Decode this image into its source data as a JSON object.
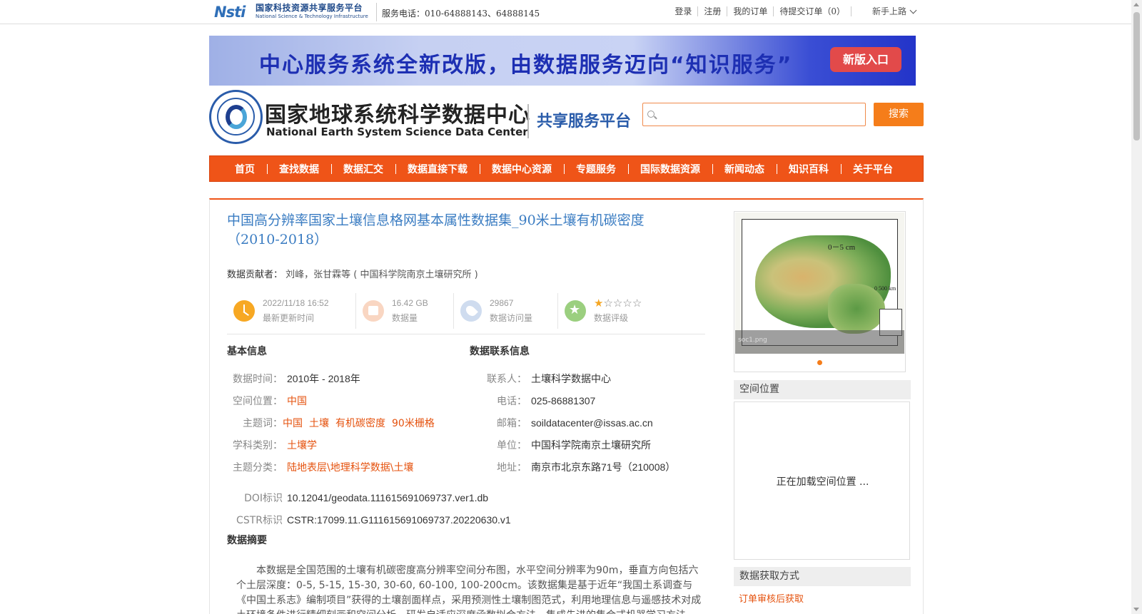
{
  "topbar": {
    "logo_mark": "Nsti",
    "logo_cn": "国家科技资源共享服务平台",
    "logo_en": "National Science & Technology Infrastructure",
    "service_tel": "服务电话：010-64888143、64888145",
    "links": [
      "登录",
      "注册",
      "我的订单",
      "待提交订单（0）"
    ],
    "newbie": "新手上路"
  },
  "banner": {
    "text": "中心服务系统全新改版，由数据服务迈向“知识服务”",
    "button": "新版入口"
  },
  "header": {
    "center_cn": "国家地球系统科学数据中心",
    "center_en": "National Earth System Science Data Center",
    "platform": "共享服务平台",
    "search_placeholder": "",
    "search_button": "搜索"
  },
  "nav": [
    "首页",
    "查找数据",
    "数据汇交",
    "数据直接下载",
    "数据中心资源",
    "专题服务",
    "国际数据资源",
    "新闻动态",
    "知识百科",
    "关于平台"
  ],
  "dataset": {
    "title": "中国高分辨率国家土壤信息格网基本属性数据集_90米土壤有机碳密度（2010-2018）",
    "contributors_label": "数据贡献者：",
    "contributors": "刘峰，张甘霖等 ( 中国科学院南京土壤研究所 )",
    "stats": {
      "updated_value": "2022/11/18 16:52",
      "updated_label": "最新更新时间",
      "size_value": "16.42 GB",
      "size_label": "数据量",
      "visits_value": "29867",
      "visits_label": "数据访问量",
      "rating_label": "数据评级",
      "rating": 1,
      "rating_max": 5,
      "star_on": "★",
      "star_off": "☆"
    }
  },
  "basic_info": {
    "title": "基本信息",
    "time_label": "数据时间：",
    "time_value": "2010年 - 2018年",
    "space_label": "空间位置：",
    "space_value": "中国",
    "keywords_label": "主题词：",
    "keywords": [
      "中国",
      "土壤",
      "有机碳密度",
      "90米栅格"
    ],
    "discipline_label": "学科类别：",
    "discipline_value": "土壤学",
    "category_label": "主题分类：",
    "category_value": "陆地表层\\地理科学数据\\土壤",
    "doi_label": "DOI标识",
    "doi_value": "10.12041/geodata.111615691069737.ver1.db",
    "cstr_label": "CSTR标识",
    "cstr_value": "CSTR:17099.11.G111615691069737.20220630.v1"
  },
  "contact_info": {
    "title": "数据联系信息",
    "contact_label": "联系人：",
    "contact_value": "土壤科学数据中心",
    "phone_label": "电话：",
    "phone_value": "025-86881307",
    "email_label": "邮箱：",
    "email_value": "soildatacenter@issas.ac.cn",
    "org_label": "单位：",
    "org_value": "中国科学院南京土壤研究所",
    "address_label": "地址：",
    "address_value": "南京市北京东路71号（210008）"
  },
  "abstract": {
    "title": "数据摘要",
    "text": "本数据是全国范围的土壤有机碳密度高分辨率空间分布图，水平空间分辨率为90m，垂直方向包括六个土层深度：0-5, 5-15, 15-30, 30-60, 60-100, 100-200cm。该数据集是基于近年“我国土系调查与《中国土系志》编制项目”获得的土壤剖面样点，采用预测性土壤制图范式，利用地理信息与遥感技术对成土环境条件进行精细刻画和空间分析，研发自适应深度函数拟合方法，集成先进的集合式机器学习方法，生成了中"
  },
  "sidebar": {
    "map_title": "0－5 cm",
    "map_scale": "0    500 km",
    "map_caption": "soc1.png",
    "spatial_title": "空间位置",
    "spatial_loading": "正在加载空间位置 ...",
    "acquire_title": "数据获取方式",
    "acquire_value": "订单审核后获取"
  }
}
